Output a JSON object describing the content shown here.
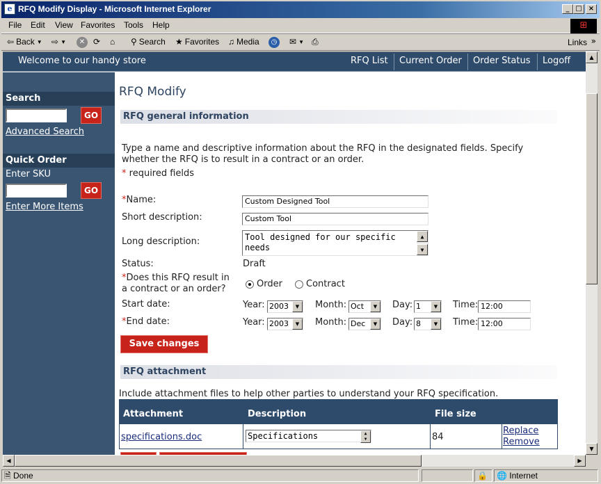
{
  "window": {
    "title": "RFQ Modify Display - Microsoft Internet Explorer",
    "minimize": "_",
    "maximize": "□",
    "close": "×"
  },
  "menu": [
    "File",
    "Edit",
    "View",
    "Favorites",
    "Tools",
    "Help"
  ],
  "toolbar": {
    "back": "Back",
    "search": "Search",
    "favorites": "Favorites",
    "media": "Media",
    "links": "Links"
  },
  "header": {
    "welcome": "Welcome to our handy store",
    "nav": [
      "RFQ List",
      "Current Order",
      "Order Status",
      "Logoff"
    ]
  },
  "sidebar": {
    "search_title": "Search",
    "go": "GO",
    "advanced_search": "Advanced Search",
    "quick_order_title": "Quick Order",
    "enter_sku": "Enter SKU",
    "enter_more_items": "Enter More Items"
  },
  "main": {
    "page_title": "RFQ Modify",
    "general_section": "RFQ general information",
    "intro_line1": "Type a name and descriptive information about the RFQ in the designated fields. Specify",
    "intro_line2": "whether the RFQ is to result in a contract or an order.",
    "required_mark": "*",
    "required_note": "required fields",
    "labels": {
      "name": "Name:",
      "short_description": "Short description:",
      "long_description": "Long description:",
      "status": "Status:",
      "result_line1": "Does this RFQ result in",
      "result_line2": "a contract or an order?",
      "start_date": "Start date:",
      "end_date": "End date:",
      "year": "Year:",
      "month": "Month:",
      "day": "Day:",
      "time": "Time:"
    },
    "values": {
      "name": "Custom Designed Tool",
      "short_description": "Custom Tool",
      "long_description_line1": "Tool designed for our specific",
      "long_description_line2": "needs",
      "status": "Draft",
      "option_order": "Order",
      "option_contract": "Contract",
      "selected_option": "Order",
      "start": {
        "year": "2003",
        "month": "Oct",
        "day": "1",
        "time": "12:00"
      },
      "end": {
        "year": "2003",
        "month": "Dec",
        "day": "8",
        "time": "12:00"
      }
    },
    "save_button": "Save changes",
    "attachment_section": "RFQ attachment",
    "attachment_intro": "Include attachment files to help other parties to understand your RFQ specification.",
    "attachment_table": {
      "columns": [
        "Attachment",
        "Description",
        "File size"
      ],
      "rows": [
        {
          "attachment": "specifications.doc",
          "description": "Specifications",
          "file_size": "84",
          "replace": "Replace",
          "remove": "Remove"
        }
      ]
    }
  },
  "status_bar": {
    "text": "Done",
    "zone": "Internet"
  },
  "colors": {
    "header_bg": "#2e4b6b",
    "sidebar_bg": "#3a5572",
    "accent_red": "#c8231b",
    "section_text": "#2e4460"
  }
}
